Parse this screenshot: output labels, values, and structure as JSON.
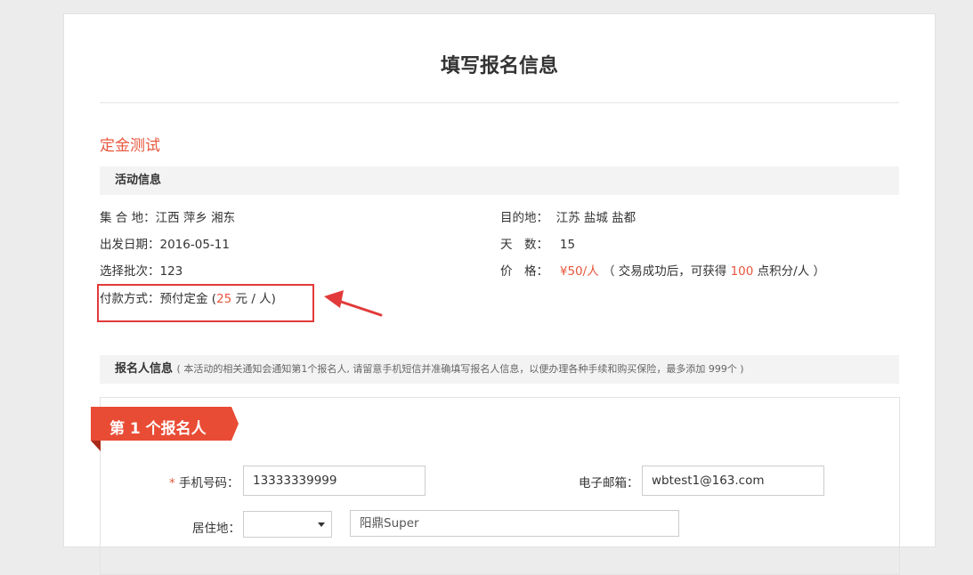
{
  "page": {
    "title": "填写报名信息",
    "event_name": "定金测试"
  },
  "activity": {
    "section_title": "活动信息",
    "gather_label": "集 合 地：",
    "gather_value": "江西 萍乡 湘东",
    "destination_label": "目的地：",
    "destination_value": "江苏 盐城 盐都",
    "date_label": "出发日期：",
    "date_value": "2016-05-11",
    "days_label": "天　数：",
    "days_value": "15",
    "batch_label": "选择批次：",
    "batch_value": "123",
    "price_label": "价　格：",
    "price_value": "¥50/人",
    "price_note_pre": "（ 交易成功后，可获得",
    "price_points": "100",
    "price_note_post": "点积分/人 ）",
    "payment_label": "付款方式：",
    "payment_value": "预付定金 (",
    "payment_amount": "25",
    "payment_unit": "元 / 人)"
  },
  "registrant": {
    "section_title": "报名人信息",
    "section_note": "( 本活动的相关通知会通知第1个报名人, 请留意手机短信并准确填写报名人信息，以便办理各种手续和购买保险，最多添加 999个 )",
    "ribbon_label": "第 1 个报名人",
    "phone_required": "*",
    "phone_label": "手机号码：",
    "phone_value": "13333339999",
    "email_label": "电子邮箱：",
    "email_value": "wbtest1@163.com",
    "residence_label": "居住地：",
    "residence_text": "阳鼎Super"
  },
  "colors": {
    "accent": "#e8573d",
    "ribbon": "#e94c35",
    "highlight": "#e23a3a"
  }
}
